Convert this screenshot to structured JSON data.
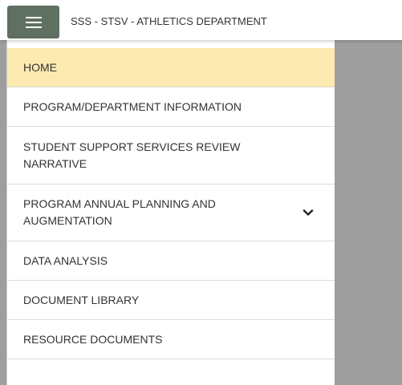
{
  "header": {
    "title": "SSS - STSV - ATHLETICS DEPARTMENT"
  },
  "icons": {
    "menu": "hamburger-menu-icon",
    "expand": "chevron-down-icon"
  },
  "colors": {
    "menu_button_bg": "#5f6f61",
    "active_item_bg": "#fdeab0",
    "overlay": "#9e9e9e"
  },
  "nav": {
    "items": [
      {
        "label": "HOME",
        "active": true
      },
      {
        "label": "PROGRAM/DEPARTMENT INFORMATION"
      },
      {
        "label": "STUDENT SUPPORT SERVICES REVIEW NARRATIVE"
      },
      {
        "label": "PROGRAM ANNUAL PLANNING AND AUGMENTATION",
        "expandable": true
      },
      {
        "label": "DATA ANALYSIS"
      },
      {
        "label": "DOCUMENT LIBRARY"
      },
      {
        "label": "RESOURCE DOCUMENTS"
      }
    ]
  }
}
